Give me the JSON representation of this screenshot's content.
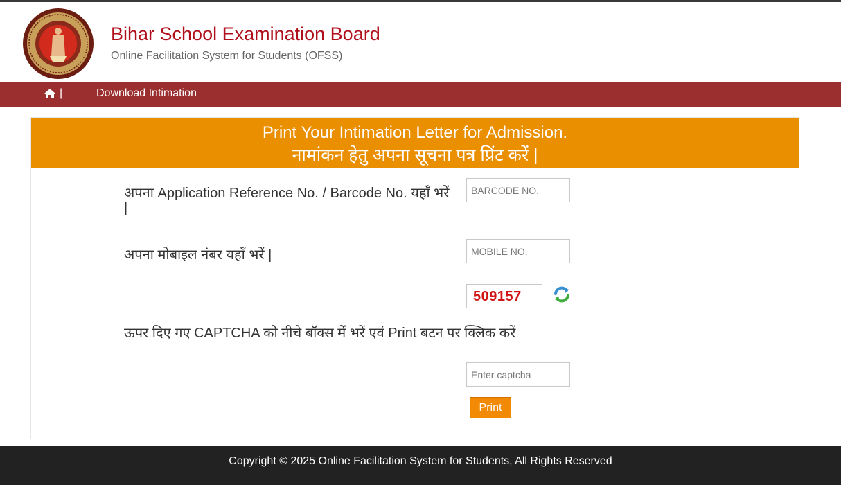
{
  "header": {
    "title": "Bihar School Examination Board",
    "subtitle": "Online Facilitation System for Students (OFSS)"
  },
  "nav": {
    "separator": "|",
    "items": [
      {
        "label": "Download Intimation"
      }
    ]
  },
  "panel": {
    "heading_en": "Print Your Intimation Letter for Admission.",
    "heading_hi": "नामांकन हेतु अपना सूचना पत्र प्रिंट करें |"
  },
  "form": {
    "barcode_label": "अपना Application Reference No. / Barcode No. यहाँ भरें |",
    "barcode_placeholder": "BARCODE NO.",
    "mobile_label": "अपना मोबाइल नंबर यहाँ भरें |",
    "mobile_placeholder": "MOBILE NO.",
    "captcha_code": "509157",
    "captcha_label": "ऊपर दिए गए CAPTCHA को नीचे बॉक्स में भरें एवं Print बटन पर क्लिक करें",
    "captcha_placeholder": "Enter captcha",
    "print_label": "Print"
  },
  "footer": {
    "text": "Copyright © 2025 Online Facilitation System for Students, All Rights Reserved"
  },
  "colors": {
    "brand_red": "#b0101c",
    "navbar": "#9b2f30",
    "heading_orange": "#ea8f00",
    "button_orange": "#f28a05",
    "captcha_text": "#d11414",
    "footer": "#222222"
  },
  "icons": {
    "home": "home-icon",
    "refresh": "refresh-icon",
    "logo": "bseb-seal-logo"
  }
}
